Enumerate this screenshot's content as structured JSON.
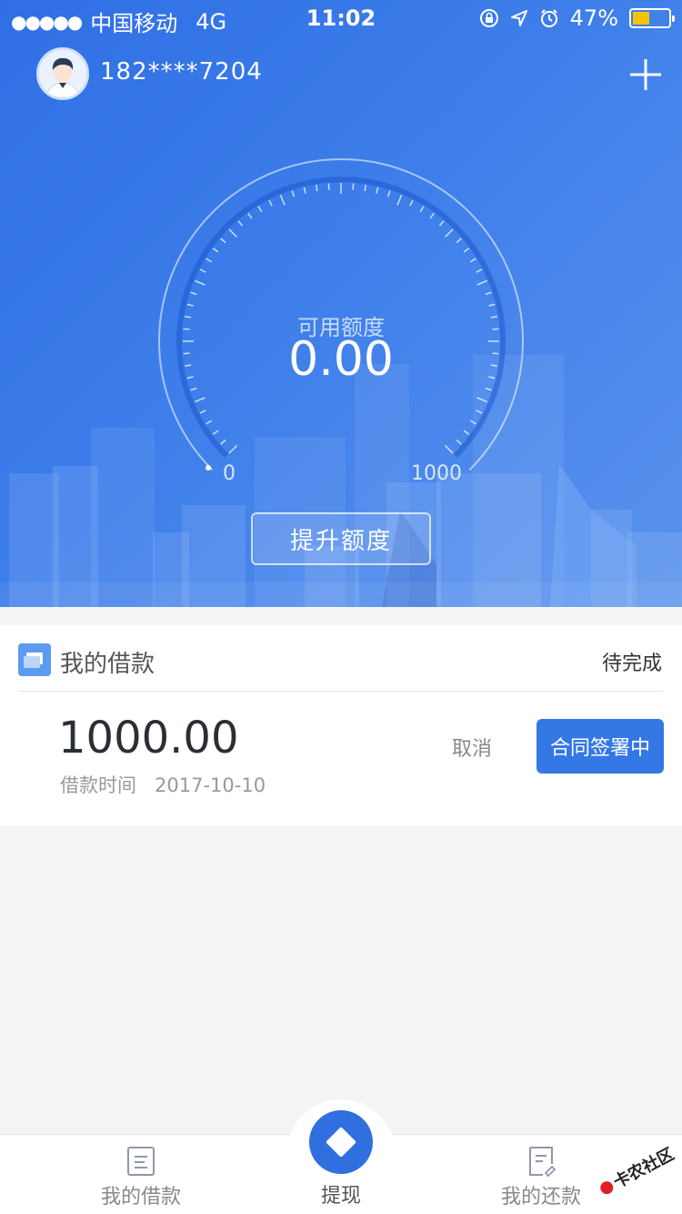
{
  "status_bar": {
    "signal": "●●●●●",
    "carrier": "中国移动",
    "network": "4G",
    "time": "11:02",
    "battery_percent": "47%",
    "battery_level": 0.47,
    "battery_color": "#f5c400"
  },
  "header": {
    "phone": "182****7204",
    "avatar_icon": "user-avatar-icon",
    "add_icon": "plus-icon"
  },
  "gauge": {
    "label": "可用额度",
    "value": "0.00",
    "min_label": "0",
    "max_label": "1000",
    "raise_button": "提升额度"
  },
  "loan": {
    "title": "我的借款",
    "status": "待完成",
    "amount": "1000.00",
    "date_label": "借款时间",
    "date": "2017-10-10",
    "cancel": "取消",
    "action": "合同签署中"
  },
  "tabbar": {
    "loans": "我的借款",
    "withdraw": "提现",
    "repay": "我的还款"
  },
  "watermark": {
    "text": "卡农社区"
  },
  "colors": {
    "primary": "#2f6fe0",
    "button": "#3478e6",
    "accent_icon": "#5b9cf2"
  }
}
